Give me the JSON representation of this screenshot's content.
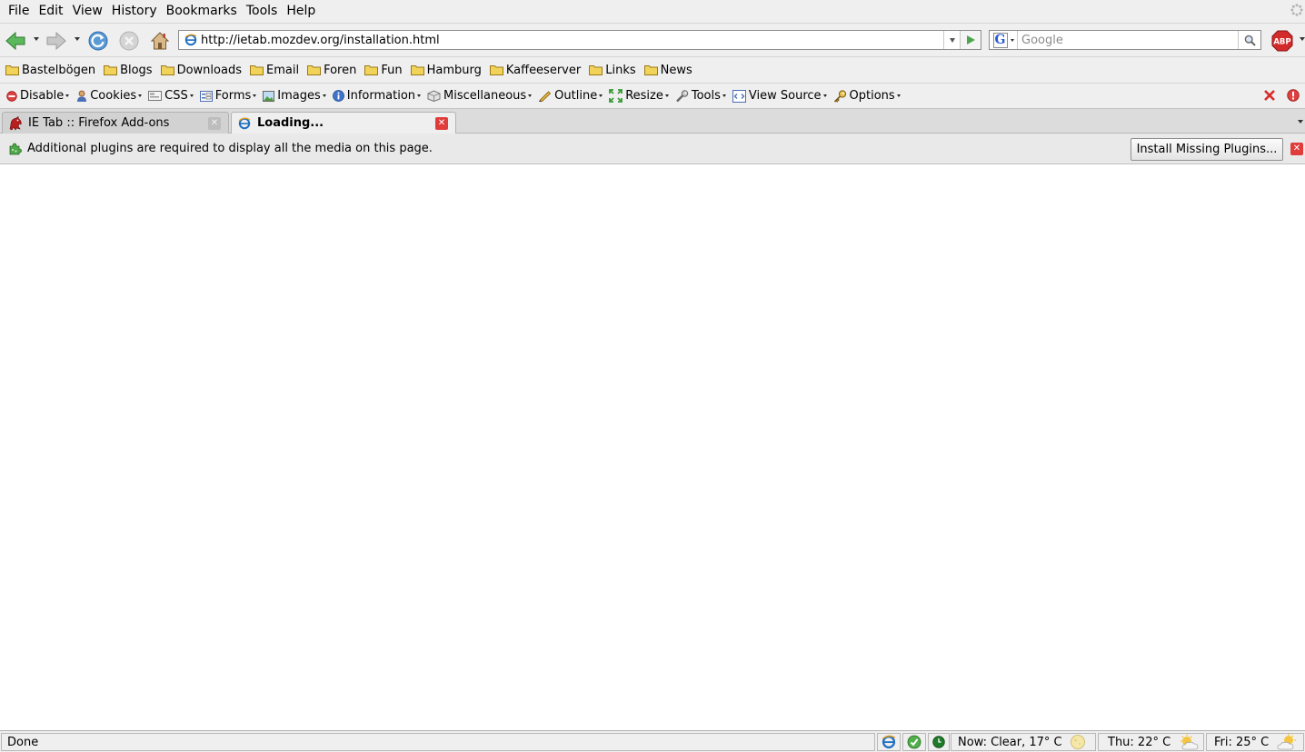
{
  "menubar": {
    "items": [
      "File",
      "Edit",
      "View",
      "History",
      "Bookmarks",
      "Tools",
      "Help"
    ]
  },
  "navbar": {
    "url": "http://ietab.mozdev.org/installation.html",
    "search_placeholder": "Google",
    "search_engine_letter": "G",
    "abp_label": "ABP"
  },
  "bookmarks": {
    "items": [
      "Bastelbögen",
      "Blogs",
      "Downloads",
      "Email",
      "Foren",
      "Fun",
      "Hamburg",
      "Kaffeeserver",
      "Links",
      "News"
    ]
  },
  "devbar": {
    "items": [
      "Disable",
      "Cookies",
      "CSS",
      "Forms",
      "Images",
      "Information",
      "Miscellaneous",
      "Outline",
      "Resize",
      "Tools",
      "View Source",
      "Options"
    ]
  },
  "tabs": [
    {
      "title": "IE Tab :: Firefox Add-ons",
      "active": false
    },
    {
      "title": "Loading...",
      "active": true
    }
  ],
  "notification": {
    "message": "Additional plugins are required to display all the media on this page.",
    "button_label": "Install Missing Plugins..."
  },
  "statusbar": {
    "status": "Done",
    "weather_now": "Now: Clear, 17° C",
    "weather_thu": "Thu: 22° C",
    "weather_fri": "Fri: 25° C"
  },
  "colors": {
    "chrome_bg": "#efefef",
    "tab_strip_bg": "#dcdcdc",
    "close_red": "#e03c3c",
    "back_arrow_green": "#4aa84a",
    "folder_yellow": "#f2d35a"
  }
}
